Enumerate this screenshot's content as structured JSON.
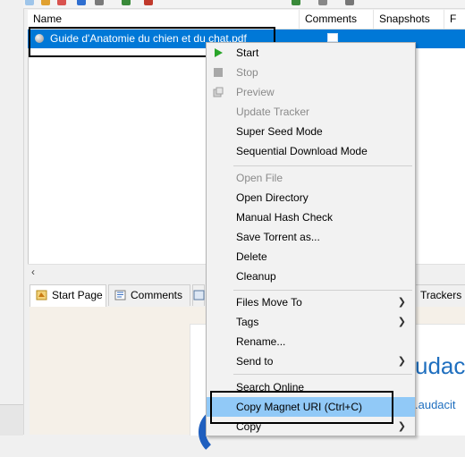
{
  "list": {
    "columns": [
      "Name",
      "Comments",
      "Snapshots",
      "F"
    ],
    "row": {
      "name": "Guide d'Anatomie du chien et du chat.pdf"
    }
  },
  "tabs": [
    {
      "label": "Start Page",
      "icon": "start-page-icon"
    },
    {
      "label": "Comments",
      "icon": "comments-icon"
    },
    {
      "label": "",
      "icon": "tab-icon"
    },
    {
      "label": "Trackers"
    }
  ],
  "content": {
    "title_fragment": "udac",
    "url_fragment": ".audacit"
  },
  "context_menu": {
    "items": [
      {
        "label": "Start",
        "enabled": true,
        "icon": "play-icon"
      },
      {
        "label": "Stop",
        "enabled": false,
        "icon": "stop-icon"
      },
      {
        "label": "Preview",
        "enabled": false,
        "icon": "preview-icon"
      },
      {
        "label": "Update Tracker",
        "enabled": false
      },
      {
        "label": "Super Seed Mode",
        "enabled": true
      },
      {
        "label": "Sequential Download Mode",
        "enabled": true
      },
      {
        "label": "Open File",
        "enabled": false
      },
      {
        "label": "Open Directory",
        "enabled": true
      },
      {
        "label": "Manual Hash Check",
        "enabled": true
      },
      {
        "label": "Save Torrent as...",
        "enabled": true
      },
      {
        "label": "Delete",
        "enabled": true
      },
      {
        "label": "Cleanup",
        "enabled": true
      },
      {
        "label": "Files Move To",
        "enabled": true,
        "submenu": true
      },
      {
        "label": "Tags",
        "enabled": true,
        "submenu": true
      },
      {
        "label": "Rename...",
        "enabled": true
      },
      {
        "label": "Send to",
        "enabled": true,
        "submenu": true
      },
      {
        "label": "Search Online",
        "enabled": true
      },
      {
        "label": "Copy Magnet URI  (Ctrl+C)",
        "enabled": true,
        "highlighted": true
      },
      {
        "label": "Copy",
        "enabled": true,
        "submenu": true
      }
    ]
  },
  "colors": {
    "selection": "#0078d7",
    "menu_highlight": "#91c9f7",
    "brand_blue": "#1f6fbf",
    "play_green": "#2aa52a"
  }
}
